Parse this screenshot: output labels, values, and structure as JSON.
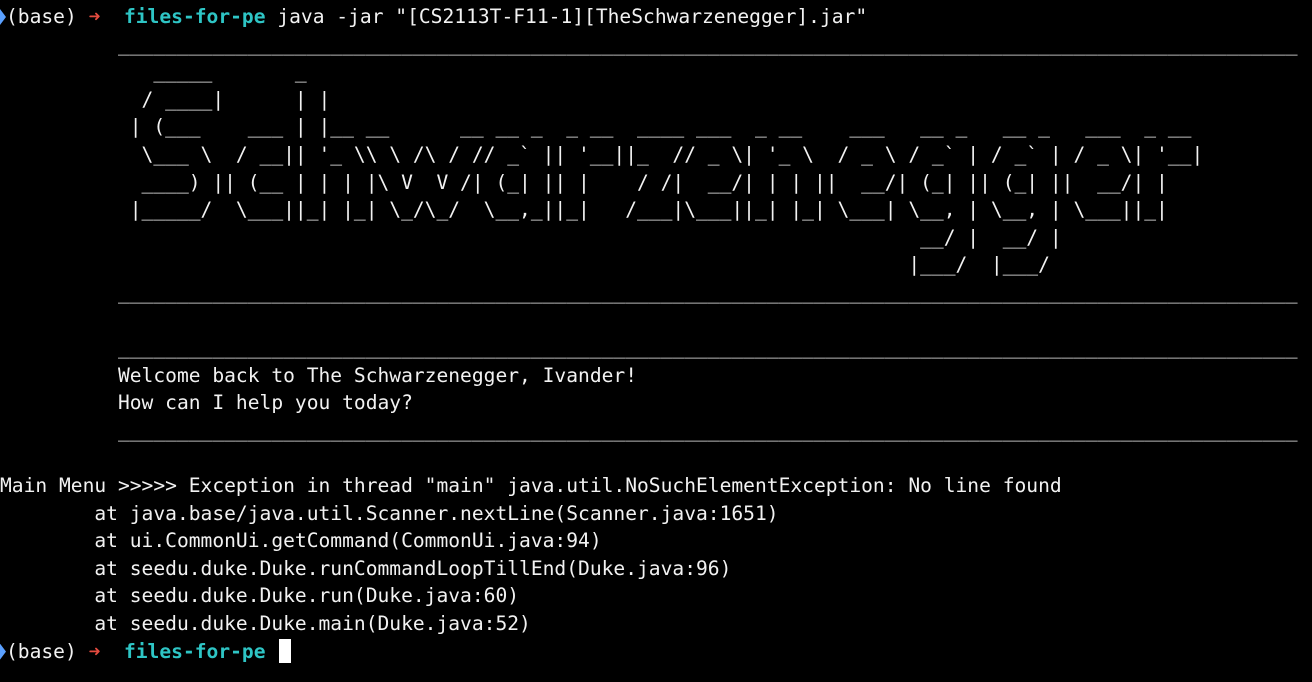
{
  "colors": {
    "background": "#000000",
    "text": "#f2f2f2",
    "prompt_arrow": "#e44b3f",
    "cwd": "#2ec5c5",
    "edge_marker": "#5aa0ff"
  },
  "prompt": {
    "env": "(base)",
    "arrow": "➜",
    "cwd": "files-for-pe"
  },
  "command": "java -jar \"[CS2113T-F11-1][TheSchwarzenegger].jar\"",
  "divider": "          ____________________________________________________________________________________________________",
  "banner_lines": [
    "             _____       _",
    "            / ____|      | |",
    "           | (___    ___ | |__ __      __ __ _  _ __  ____ ___  _ __    ___   __ _   __ _   ___  _ __",
    "            \\___ \\  / __|| '_ \\\\ \\ /\\ / // _` || '__||_  // _ \\| '_ \\  / _ \\ / _` | / _` | / _ \\| '__|",
    "            ____) || (__ | | | |\\ V  V /| (_| || |    / /|  __/| | | ||  __/| (_| || (_| ||  __/| |",
    "           |_____/  \\___||_| |_| \\_/\\_/  \\__,_||_|   /___|\\___||_| |_| \\___| \\__, | \\__, | \\___||_|",
    "                                                                              __/ |  __/ |",
    "                                                                             |___/  |___/"
  ],
  "welcome_lines": [
    "          Welcome back to The Schwarzenegger, Ivander!",
    "          How can I help you today?"
  ],
  "exception_line": "Main Menu >>>>> Exception in thread \"main\" java.util.NoSuchElementException: No line found",
  "stack_trace": [
    "        at java.base/java.util.Scanner.nextLine(Scanner.java:1651)",
    "        at ui.CommonUi.getCommand(CommonUi.java:94)",
    "        at seedu.duke.Duke.runCommandLoopTillEnd(Duke.java:96)",
    "        at seedu.duke.Duke.run(Duke.java:60)",
    "        at seedu.duke.Duke.main(Duke.java:52)"
  ]
}
